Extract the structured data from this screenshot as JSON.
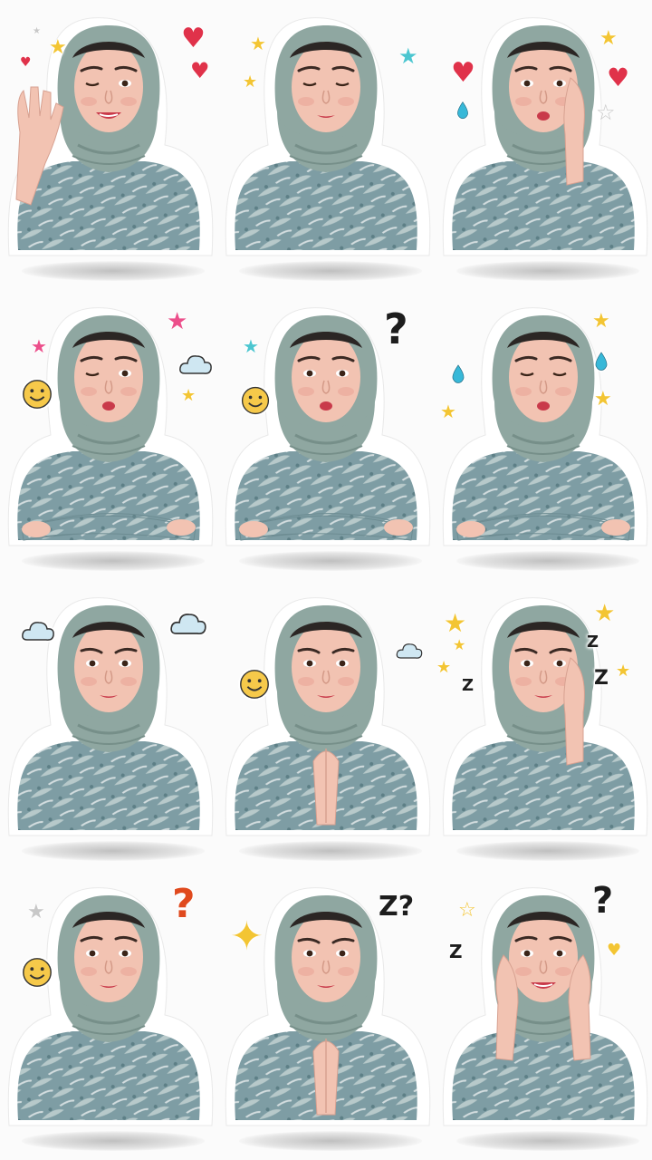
{
  "sheet": {
    "rows": 4,
    "columns": 3,
    "colors": {
      "background": "#fbfbfb",
      "hijab": "#8fa7a1",
      "blouse": "#7e9da4",
      "skin": "#f2c3b2",
      "lips": "#c93a4a",
      "sticker_border": "#ffffff"
    }
  },
  "stickers": [
    {
      "expression": "wink-smile",
      "pose": "waving-hand",
      "decorations": [
        "heart",
        "star",
        "heart",
        "heart",
        "star-small"
      ]
    },
    {
      "expression": "eyes-closed",
      "pose": "neutral",
      "decorations": [
        "star",
        "star-cyan",
        "star"
      ]
    },
    {
      "expression": "kiss",
      "pose": "hand-on-cheek",
      "decorations": [
        "heart",
        "droplet",
        "star",
        "heart",
        "star-outline"
      ]
    },
    {
      "expression": "wink-kiss",
      "pose": "arms-crossed",
      "decorations": [
        "star-pink",
        "smiley",
        "star-pink",
        "cloud",
        "star"
      ]
    },
    {
      "expression": "pout",
      "pose": "arms-crossed",
      "decorations": [
        "star-cyan",
        "smiley",
        "question-mark"
      ]
    },
    {
      "expression": "eyes-closed-pout",
      "pose": "arms-crossed",
      "decorations": [
        "droplet",
        "star",
        "star",
        "droplet",
        "star"
      ]
    },
    {
      "expression": "serious",
      "pose": "neutral",
      "decorations": [
        "cloud",
        "cloud"
      ]
    },
    {
      "expression": "frown",
      "pose": "praying-hands",
      "decorations": [
        "smiley",
        "cloud"
      ]
    },
    {
      "expression": "frown",
      "pose": "hand-on-cheek",
      "decorations": [
        "star",
        "star",
        "star",
        "z",
        "z",
        "z",
        "star",
        "star"
      ]
    },
    {
      "expression": "neutral",
      "pose": "neutral",
      "decorations": [
        "star-outline",
        "smiley",
        "question-mark"
      ]
    },
    {
      "expression": "frown",
      "pose": "praying-hands",
      "decorations": [
        "sparkle",
        "z-question"
      ]
    },
    {
      "expression": "smile",
      "pose": "hands-on-cheeks",
      "decorations": [
        "star-outline",
        "z",
        "question-mark",
        "heart"
      ]
    }
  ],
  "glyphs": {
    "heart": "♥",
    "star": "★",
    "star_outline": "☆",
    "sparkle": "✦",
    "question": "?",
    "z": "Z",
    "z_question": "Z?"
  }
}
